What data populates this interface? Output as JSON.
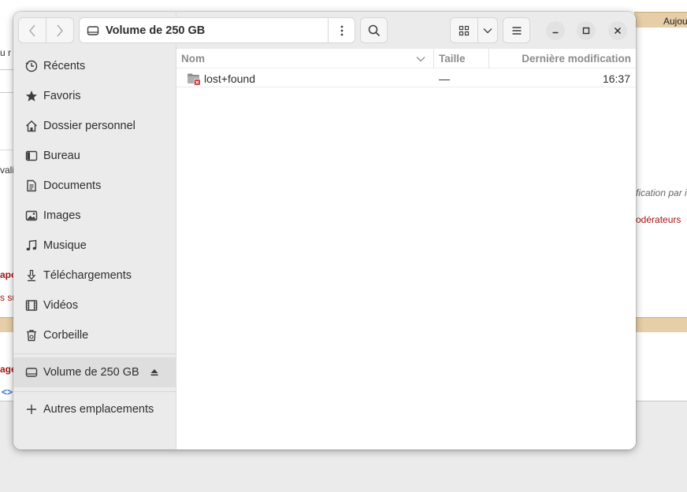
{
  "background_page": {
    "fragments": [
      "Aujou",
      "u r",
      "vali",
      "fication par i",
      "odérateurs",
      "apo",
      "s su",
      "age",
      "<>"
    ]
  },
  "header": {
    "back_icon": "chevron-left-icon",
    "forward_icon": "chevron-right-icon",
    "path_label": "Volume de 250 GB",
    "drive_icon": "drive-icon",
    "path_menu_icon": "kebab-menu-icon",
    "search_icon": "search-icon",
    "view_icon": "grid-view-icon",
    "view_dropdown_icon": "chevron-down-icon",
    "menu_icon": "hamburger-menu-icon"
  },
  "window_controls": {
    "minimize_icon": "minimize-icon",
    "maximize_icon": "maximize-icon",
    "close_icon": "close-icon"
  },
  "sidebar": {
    "items": [
      {
        "label": "Récents",
        "icon": "clock-icon"
      },
      {
        "label": "Favoris",
        "icon": "star-icon"
      },
      {
        "label": "Dossier personnel",
        "icon": "home-icon"
      },
      {
        "label": "Bureau",
        "icon": "desktop-icon"
      },
      {
        "label": "Documents",
        "icon": "document-icon"
      },
      {
        "label": "Images",
        "icon": "image-icon"
      },
      {
        "label": "Musique",
        "icon": "music-icon"
      },
      {
        "label": "Téléchargements",
        "icon": "download-icon"
      },
      {
        "label": "Vidéos",
        "icon": "film-icon"
      },
      {
        "label": "Corbeille",
        "icon": "trash-icon"
      }
    ],
    "volume": {
      "label": "Volume de 250 GB",
      "icon": "drive-icon",
      "eject_icon": "eject-icon"
    },
    "other": {
      "label": "Autres emplacements",
      "icon": "plus-icon"
    }
  },
  "list": {
    "columns": {
      "name": "Nom",
      "size": "Taille",
      "modified": "Dernière modification"
    },
    "sort_icon": "chevron-down-icon",
    "rows": [
      {
        "name": "lost+found",
        "size": "—",
        "modified": "16:37",
        "icon": "locked-folder-icon"
      }
    ]
  },
  "colors": {
    "accent_band": "#e6cfa8",
    "link_red": "#a31515",
    "folder_lock_badge": "#c01c28"
  }
}
